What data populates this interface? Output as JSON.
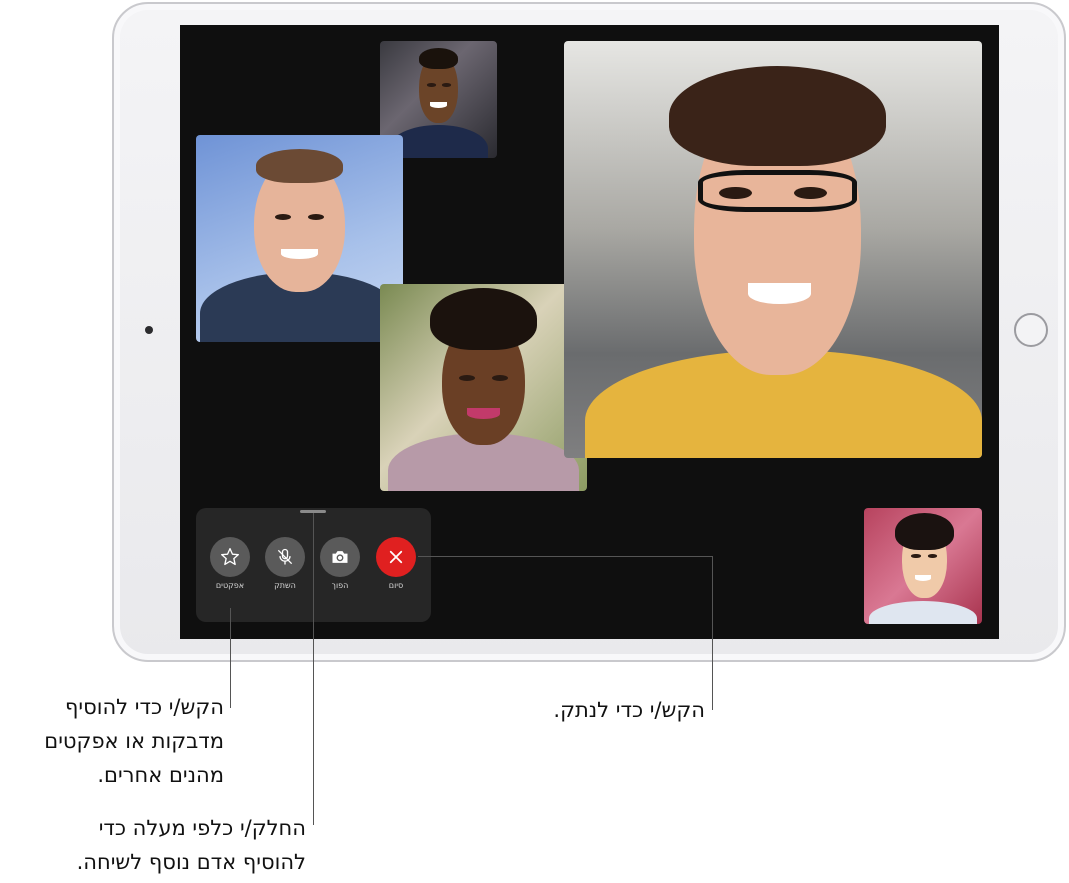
{
  "call": {
    "controls": {
      "effects_label": "אפקטים",
      "mute_label": "השתק",
      "flip_label": "הפוך",
      "end_label": "סיום"
    }
  },
  "callouts": {
    "disconnect": "הקש/י כדי לנתק.",
    "effects_lines": [
      "הקש/י כדי להוסיף",
      "מדבקות או אפקטים",
      "מהנים אחרים."
    ],
    "add_person_lines": [
      "החלק/י כלפי מעלה כדי",
      "להוסיף אדם נוסף לשיחה."
    ]
  },
  "icons": {
    "effects": "star-icon",
    "mute": "microphone-slash-icon",
    "flip": "camera-flip-icon",
    "end": "close-icon"
  },
  "colors": {
    "end_button": "#e02020",
    "control_button": "#5a5a5a",
    "screen": "#0f0f0f"
  }
}
